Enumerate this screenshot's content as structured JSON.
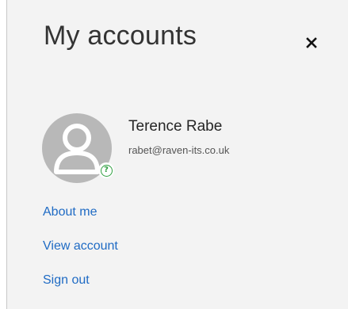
{
  "panel": {
    "title": "My accounts",
    "close_icon": "close-icon"
  },
  "account": {
    "name": "Terence Rabe",
    "email": "rabet@raven-its.co.uk",
    "avatar_icon": "person-placeholder-icon",
    "presence_status": "unknown",
    "presence_glyph": "?"
  },
  "links": {
    "about_me": "About me",
    "view_account": "View account",
    "sign_out": "Sign out"
  },
  "colors": {
    "panel_background": "#f3f3f3",
    "link": "#1f6bc4",
    "avatar": "#b8b8b8",
    "presence": "#2e9e3f"
  }
}
